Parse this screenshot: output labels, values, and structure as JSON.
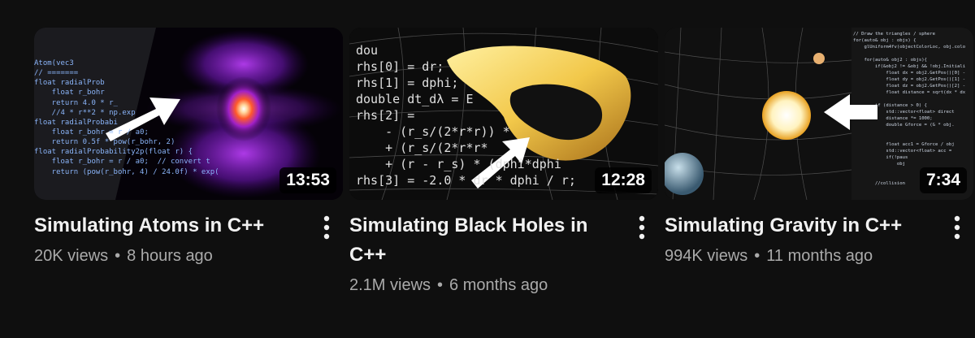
{
  "videos": [
    {
      "title": "Simulating Atoms in C++",
      "duration": "13:53",
      "views": "20K views",
      "age": "8 hours ago",
      "thumb_code": [
        "Atom(vec3",
        "// =======",
        "float radialProb",
        "    float r_bohr",
        "    return 4.0 * r_",
        "    //4 * r**2 * np.exp",
        "float radialProbabi",
        "    float r_bohr = r / a0;",
        "    return 0.5f * pow(r_bohr, 2)",
        "float radialProbability2p(float r) {",
        "    float r_bohr = r / a0;  // convert t",
        "    return (pow(r_bohr, 4) / 24.0f) * exp("
      ]
    },
    {
      "title": "Simulating Black Holes in C++",
      "duration": "12:28",
      "views": "2.1M views",
      "age": "6 months ago",
      "thumb_code": [
        "dou",
        "rhs[0] = dr;",
        "rhs[1] = dphi;",
        "double dt_dλ = E",
        "rhs[2] =",
        "    - (r_s/(2*r*r)) *",
        "    + (r_s/(2*r*r*",
        "    + (r - r_s) * (dphi*dphi",
        "rhs[3] = -2.0 * dr * dphi / r;"
      ]
    },
    {
      "title": "Simulating Gravity in C++",
      "duration": "7:34",
      "views": "994K views",
      "age": "11 months ago",
      "thumb_code": [
        "// Draw the triangles / sphere",
        "for(auto& obj : objs) {",
        "    glUniform4fv(objectColorLoc, obj.colo",
        "",
        "    for(auto& obj2 : objs){",
        "        if(&obj2 != &obj && !obj.Initiali",
        "            float dx = obj2.GetPos()[0] -",
        "            float dy = obj2.GetPos()[1] -",
        "            float dz = obj2.GetPos()[2] -",
        "            float distance = sqrt(dx * dx",
        "",
        "        if (distance > 0) {",
        "            std::vector<float> direct",
        "            distance *= 1000;",
        "            double Gforce = (G * obj.",
        "",
        "",
        "            float acc1 = Gforce / obj",
        "            std::vector<float> acc =",
        "            if(!paus",
        "                obj",
        "",
        "",
        "        //collision"
      ]
    }
  ],
  "separator": "•",
  "icons": {
    "menu": "kebab-vertical-icon",
    "arrow": "white-arrow"
  }
}
